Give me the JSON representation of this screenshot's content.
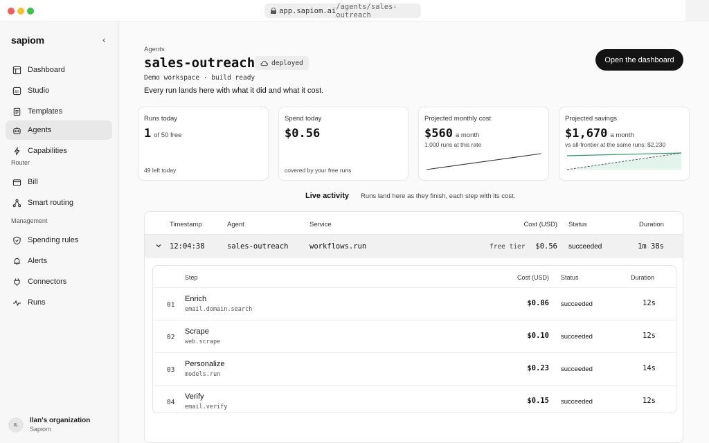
{
  "browser": {
    "url_host": "app.sapiom.ai",
    "url_path": "/agents/sales-outreach"
  },
  "sidebar": {
    "brand": "sapiom",
    "items": [
      {
        "label": "Dashboard",
        "icon": "dashboard-icon"
      },
      {
        "label": "Studio",
        "icon": "ai-icon"
      },
      {
        "label": "Templates",
        "icon": "document-icon"
      },
      {
        "label": "Agents",
        "icon": "agent-icon",
        "active": true
      },
      {
        "label": "Capabilities",
        "icon": "lightning-icon"
      }
    ],
    "router_label": "Router",
    "router_items": [
      {
        "label": "Bill",
        "icon": "wallet-icon"
      },
      {
        "label": "Smart routing",
        "icon": "routing-icon"
      }
    ],
    "management_label": "Management",
    "management_items": [
      {
        "label": "Spending rules",
        "icon": "shield-icon"
      },
      {
        "label": "Alerts",
        "icon": "bell-icon"
      },
      {
        "label": "Connectors",
        "icon": "plug-icon"
      },
      {
        "label": "Runs",
        "icon": "activity-icon"
      }
    ],
    "org": {
      "initials": "IL",
      "name": "Ilan's organization",
      "sub": "Sapiom"
    }
  },
  "header": {
    "crumb": "Agents",
    "title": "sales-outreach",
    "badge": "deployed",
    "meta": "Demo workspace · build ready",
    "tagline": "Every run lands here with what it did and what it cost.",
    "cta": "Open the dashboard"
  },
  "cards": {
    "runs": {
      "label": "Runs today",
      "value": "1",
      "unit": "of 50 free",
      "foot": "49 left today"
    },
    "spend": {
      "label": "Spend today",
      "value": "$0.56",
      "foot": "covered by your free runs"
    },
    "monthly": {
      "label": "Projected monthly cost",
      "value": "$560",
      "unit": "a month",
      "note": "1,000 runs at this rate"
    },
    "savings": {
      "label": "Projected savings",
      "value": "$1,670",
      "unit": "a month",
      "note": "vs all-frontier at the same runs: $2,230"
    }
  },
  "live": {
    "title": "Live activity",
    "subtitle": "Runs land here as they finish, each step with its cost."
  },
  "table": {
    "headers": {
      "timestamp": "Timestamp",
      "agent": "Agent",
      "service": "Service",
      "cost": "Cost (USD)",
      "status": "Status",
      "duration": "Duration"
    },
    "run": {
      "timestamp": "12:04:38",
      "agent": "sales-outreach",
      "service": "workflows.run",
      "tier": "free tier",
      "cost": "$0.56",
      "status": "succeeded",
      "duration": "1m 38s"
    },
    "step_headers": {
      "step": "Step",
      "cost": "Cost (USD)",
      "status": "Status",
      "duration": "Duration"
    },
    "steps": [
      {
        "num": "01",
        "name": "Enrich",
        "service": "email.domain.search",
        "cost": "$0.06",
        "status": "succeeded",
        "duration": "12s"
      },
      {
        "num": "02",
        "name": "Scrape",
        "service": "web.scrape",
        "cost": "$0.10",
        "status": "succeeded",
        "duration": "12s"
      },
      {
        "num": "03",
        "name": "Personalize",
        "service": "models.run",
        "cost": "$0.23",
        "status": "succeeded",
        "duration": "14s"
      },
      {
        "num": "04",
        "name": "Verify",
        "service": "email.verify",
        "cost": "$0.15",
        "status": "succeeded",
        "duration": "12s"
      }
    ]
  },
  "colors": {
    "accent": "#141414",
    "savings_line": "#2f9a6a",
    "savings_fill": "#e3f4ec"
  }
}
